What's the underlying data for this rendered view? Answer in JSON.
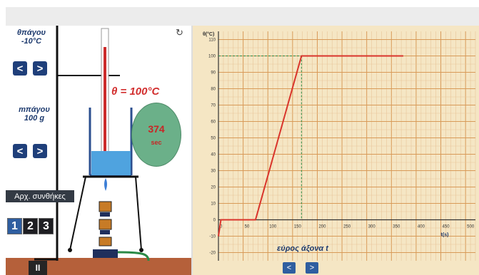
{
  "sim": {
    "ice_temp_label": "θπάγου",
    "ice_temp_sub": "",
    "ice_temp_value": "-10°C",
    "ice_mass_label": "mπάγου",
    "ice_mass_value": "100 g",
    "temperature_readout": "θ = 100°C",
    "timer_value": "374",
    "timer_unit": "sec",
    "initial_conditions_label": "Αρχ. συνθήκες",
    "preset_buttons": [
      "1",
      "2",
      "3"
    ],
    "pause_label": "II",
    "left_arrow": "<",
    "right_arrow": ">",
    "reset_icon": "↻"
  },
  "graph": {
    "axis_range_label": "εύρος άξονα t",
    "btn_prev": "<",
    "btn_next": ">"
  },
  "colors": {
    "floor": "#b5603a",
    "button": "#1f3f7a",
    "curve": "#d9342b",
    "grid_bg": "#f5e6c4",
    "timer_bg": "#6bb089"
  },
  "chart_data": {
    "type": "line",
    "title": "",
    "xlabel": "t(s)",
    "ylabel": "θ(°C)",
    "xlim": [
      0,
      520
    ],
    "ylim": [
      -25,
      115
    ],
    "x_ticks": [
      0,
      50,
      100,
      150,
      200,
      250,
      300,
      350,
      400,
      450,
      500
    ],
    "y_ticks": [
      -20,
      -10,
      0,
      10,
      20,
      30,
      40,
      50,
      60,
      70,
      80,
      90,
      100,
      110
    ],
    "grid": true,
    "series": [
      {
        "x": [
          0,
          5,
          75,
          168,
          374
        ],
        "y": [
          -10,
          0,
          0,
          100,
          100
        ]
      }
    ],
    "guides": {
      "x": 168,
      "y": 100
    }
  }
}
